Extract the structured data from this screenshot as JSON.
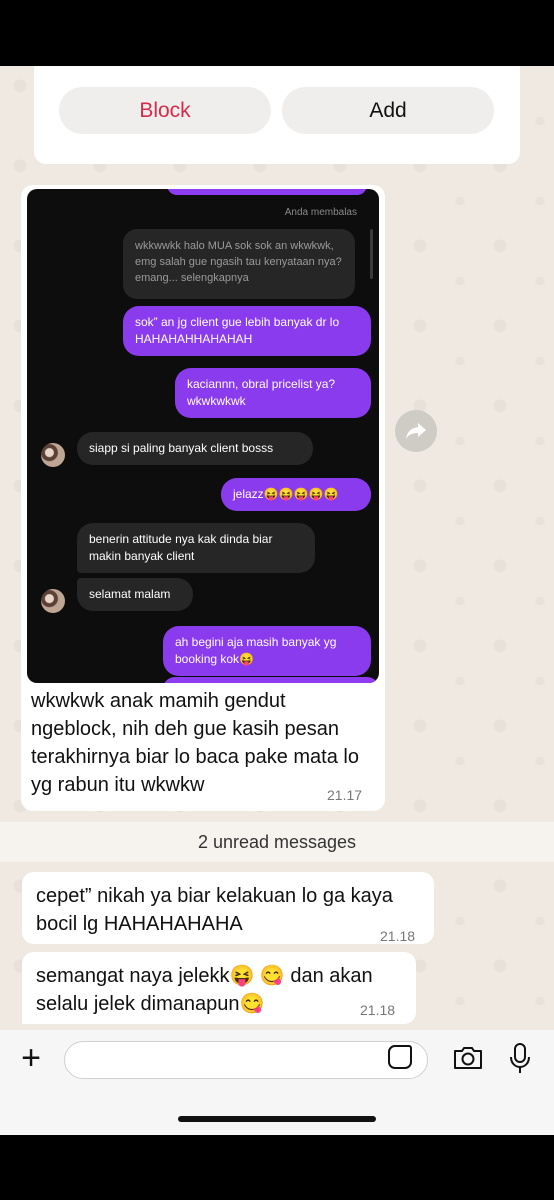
{
  "card": {
    "block_label": "Block",
    "add_label": "Add"
  },
  "screenshot": {
    "replied_label": "Anda membalas",
    "quote_text": "wkkwwkk halo MUA sok sok an wkwkwk, emg salah gue ngasih tau kenyataan nya? emang... selengkapnya",
    "messages": [
      {
        "text": "sok” an jg client gue lebih banyak dr lo HAHAHAHHAHAHAH"
      },
      {
        "text": "kaciannn, obral pricelist ya? wkwkwkwk"
      },
      {
        "text": "siapp si paling banyak client bosss"
      },
      {
        "text": "jelazz😝😝😝😝😝"
      },
      {
        "text": "benerin attitude nya kak dinda biar makin banyak client"
      },
      {
        "text": "selamat malam"
      },
      {
        "text": "ah begini aja masih banyak yg booking kok😝"
      }
    ]
  },
  "caption": {
    "text": "wkwkwk anak mamih gendut ngeblock, nih deh gue kasih pesan terakhirnya biar lo baca pake mata lo yg rabun itu wkwkw",
    "time": "21.17"
  },
  "unread_label": "2 unread messages",
  "messages": [
    {
      "text": "cepet” nikah ya biar kelakuan lo ga kaya bocil lg HAHAHAHAHA",
      "time": "21.18"
    },
    {
      "text": "semangat naya jelekk😝 😋  dan akan selalu jelek dimanapun😋",
      "time": "21.18"
    }
  ],
  "icons": [
    "plus-icon",
    "sticker-icon",
    "camera-icon",
    "microphone-icon",
    "forward-icon"
  ]
}
